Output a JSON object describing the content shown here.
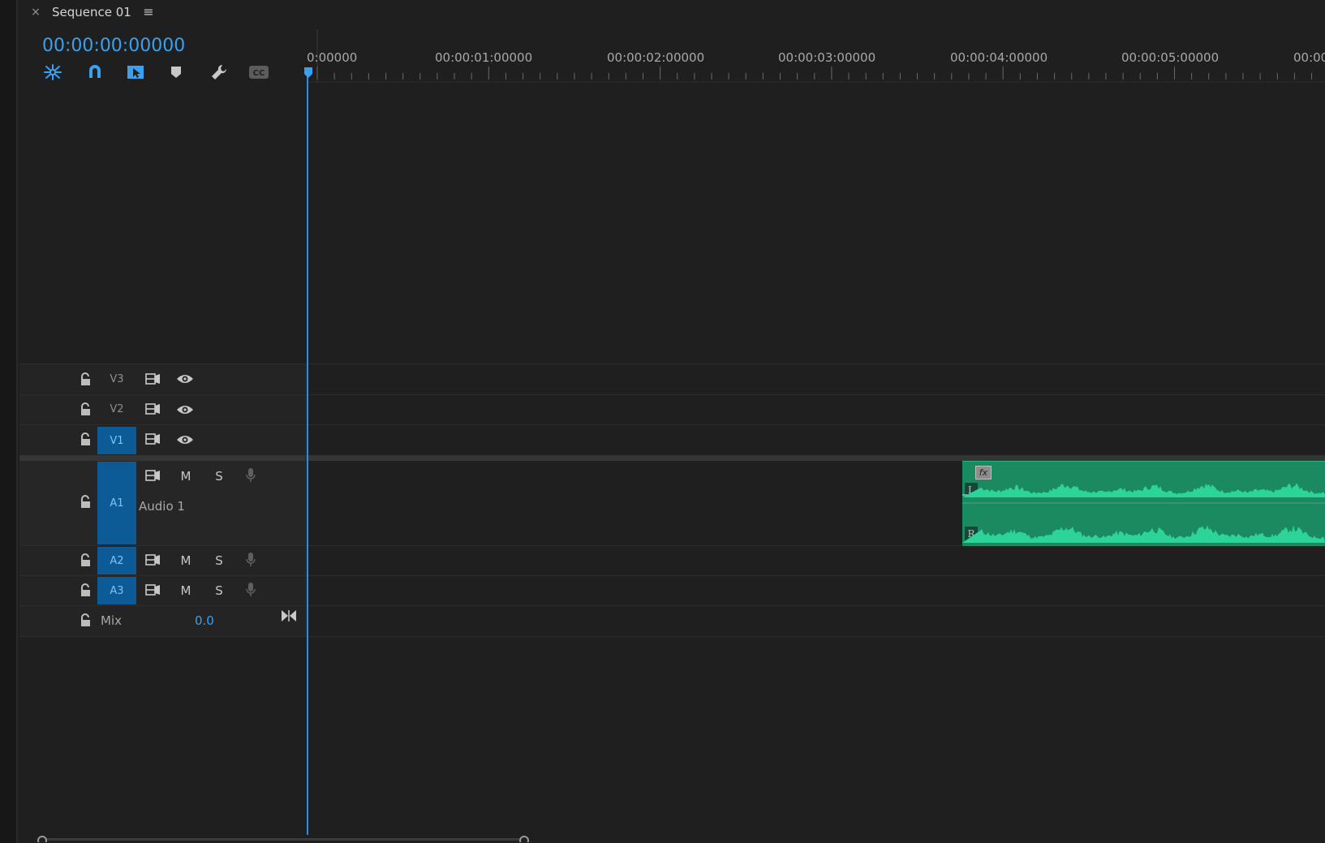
{
  "tab": {
    "close_icon": "×",
    "title": "Sequence 01",
    "menu_icon": "≡"
  },
  "timecode": "00:00:00:00000",
  "toolbar": {
    "tools": [
      "nest-sequences-icon",
      "snap-magnet-icon",
      "linked-selection-icon",
      "add-marker-icon",
      "timeline-settings-wrench-icon",
      "captions-cc-icon"
    ],
    "cc_label": "CC"
  },
  "ruler": {
    "labels": [
      "0:00000",
      "00:00:01:00000",
      "00:00:02:00000",
      "00:00:03:00000",
      "00:00:04:00000",
      "00:00:05:00000",
      "00:00:0"
    ]
  },
  "tracks": {
    "video": [
      {
        "id": "V3",
        "active": false
      },
      {
        "id": "V2",
        "active": false
      },
      {
        "id": "V1",
        "active": true
      }
    ],
    "audio": [
      {
        "id": "A1",
        "name": "Audio 1",
        "active": true,
        "m": "M",
        "s": "S"
      },
      {
        "id": "A2",
        "active": true,
        "m": "M",
        "s": "S"
      },
      {
        "id": "A3",
        "active": true,
        "m": "M",
        "s": "S"
      }
    ],
    "mix": {
      "label": "Mix",
      "value": "0.0"
    }
  },
  "clip": {
    "fx_label": "fx",
    "left_channel": "L",
    "right_channel": "R",
    "color": "#1b8a61"
  },
  "colors": {
    "accent": "#3aa0f0",
    "playhead": "#2b8ee0",
    "track_target": "#0d5b96",
    "clip": "#1b8a61"
  }
}
